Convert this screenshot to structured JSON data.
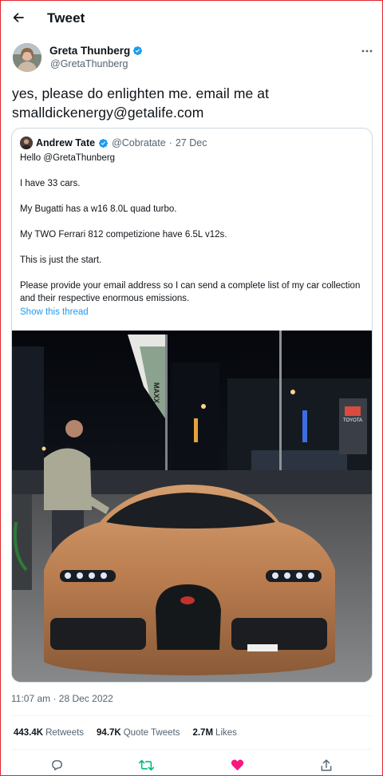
{
  "header": {
    "title": "Tweet"
  },
  "author": {
    "name": "Greta Thunberg",
    "handle": "@GretaThunberg"
  },
  "tweet": {
    "text_line1": "yes, please do enlighten me. email me at",
    "text_line2": "smalldickenergy@getalife.com"
  },
  "quote": {
    "name": "Andrew Tate",
    "handle": "@Cobratate",
    "separator": "·",
    "date": "27 Dec",
    "paragraphs": [
      "Hello @GretaThunberg",
      "I have 33 cars.",
      "My Bugatti has a w16 8.0L quad turbo.",
      "My TWO Ferrari 812 competizione have 6.5L v12s.",
      "This is just the start.",
      "Please provide your email address so I can send a complete list of my car collection and their respective enormous emissions."
    ],
    "show_thread": "Show this thread",
    "image_signs": {
      "flag": "MAXX",
      "station": "TOYOTA"
    }
  },
  "timestamp": "11:07 am · 28 Dec 2022",
  "stats": {
    "retweets_count": "443.4K",
    "retweets_label": "Retweets",
    "quotes_count": "94.7K",
    "quotes_label": "Quote Tweets",
    "likes_count": "2.7M",
    "likes_label": "Likes"
  },
  "colors": {
    "accent": "#1d9bf0",
    "retweet": "#00ba7c",
    "like": "#f91880",
    "muted": "#536471",
    "frame": "#e0252b"
  },
  "icons": [
    "back-arrow-icon",
    "verified-badge-icon",
    "more-icon",
    "reply-icon",
    "retweet-icon",
    "like-icon",
    "share-icon"
  ]
}
